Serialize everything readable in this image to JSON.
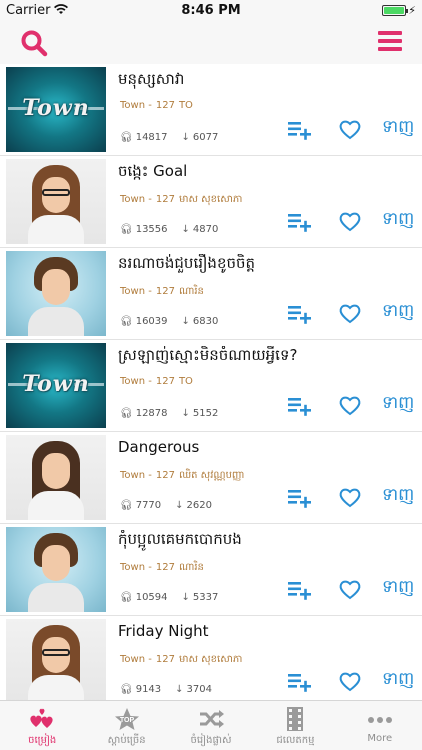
{
  "status_bar": {
    "carrier": "Carrier",
    "time": "8:46 PM",
    "charging_symbol": "⚡"
  },
  "nav": {
    "search_icon": "search-icon",
    "menu_icon": "hamburger-menu-icon",
    "accent_color": "#e0306c"
  },
  "list": {
    "action_color": "#2a8fd4",
    "download_label": "ទាញ",
    "items": [
      {
        "title": "មនុស្សសាវា",
        "artist_group": "Town -",
        "number": "127",
        "singer": "TO",
        "listens": "14817",
        "downloads": "6077",
        "thumb": "town"
      },
      {
        "title": "ចង្កេះ Goal",
        "artist_group": "Town -",
        "number": "127",
        "singer": "មាស សុខសោភា",
        "listens": "13556",
        "downloads": "4870",
        "thumb": "woman-glasses"
      },
      {
        "title": "នរណាចង់ជួបរឿងខូចចិត្ត",
        "artist_group": "Town -",
        "number": "127",
        "singer": "ណារិន",
        "listens": "16039",
        "downloads": "6830",
        "thumb": "man"
      },
      {
        "title": "ស្រឡាញ់ស្មោះមិនចំណាយអ្វីទេ?",
        "artist_group": "Town -",
        "number": "127",
        "singer": "TO",
        "listens": "12878",
        "downloads": "5152",
        "thumb": "town"
      },
      {
        "title": "Dangerous",
        "artist_group": "Town -",
        "number": "127",
        "singer": "ឈិត សុវណ្ណបញ្ញា",
        "listens": "7770",
        "downloads": "2620",
        "thumb": "woman"
      },
      {
        "title": "កុំបប្អូលគេមកបោកបង",
        "artist_group": "Town -",
        "number": "127",
        "singer": "ណារិន",
        "listens": "10594",
        "downloads": "5337",
        "thumb": "man"
      },
      {
        "title": "Friday Night",
        "artist_group": "Town -",
        "number": "127",
        "singer": "មាស សុខសោភា",
        "listens": "9143",
        "downloads": "3704",
        "thumb": "woman-glasses"
      }
    ]
  },
  "tabs": [
    {
      "label": "ចម្រៀង",
      "icon": "hearts-music-icon",
      "active": true
    },
    {
      "label": "ស្តាប់ច្រើន",
      "icon": "top-star-icon",
      "active": false
    },
    {
      "label": "ចំរៀងផ្លាស់",
      "icon": "shuffle-icon",
      "active": false
    },
    {
      "label": "ជលេតកម្ម",
      "icon": "film-strip-icon",
      "active": false
    },
    {
      "label": "More",
      "icon": "more-dots-icon",
      "active": false
    }
  ]
}
